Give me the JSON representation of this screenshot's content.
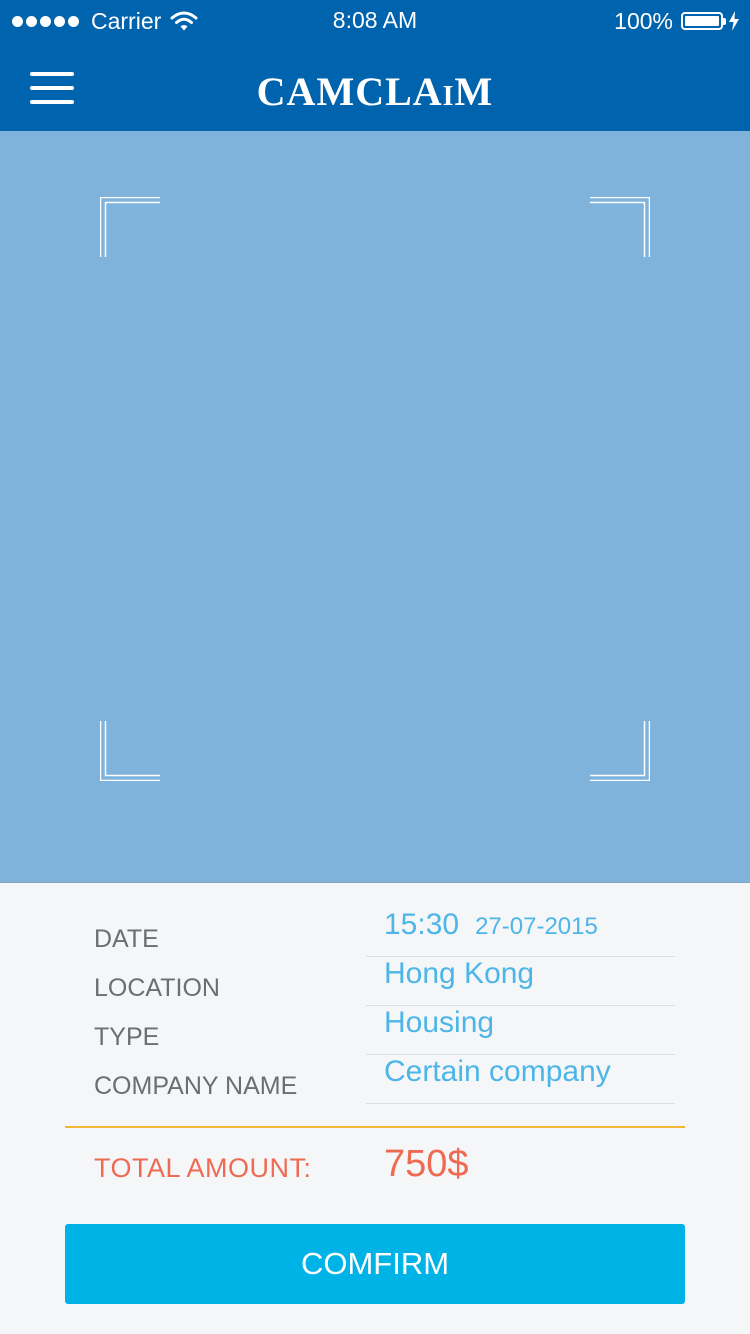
{
  "status_bar": {
    "carrier": "Carrier",
    "time": "8:08 AM",
    "battery": "100%",
    "icons": [
      "signal-dots-icon",
      "wifi-icon",
      "battery-icon",
      "charging-bolt-icon"
    ]
  },
  "header": {
    "app_title": "CAMCLAiM",
    "menu_icon": "hamburger-menu-icon"
  },
  "viewfinder": {
    "icons": [
      "corner-bracket-icon"
    ],
    "background_color": "#7fb3db"
  },
  "details": {
    "fields": [
      {
        "label": "DATE",
        "time": "15:30",
        "date": "27-07-2015"
      },
      {
        "label": "LOCATION",
        "value": "Hong Kong"
      },
      {
        "label": "TYPE",
        "value": "Housing"
      },
      {
        "label": "COMPANY NAME",
        "value": "Certain company"
      }
    ],
    "total_label": "TOTAL AMOUNT:",
    "total_value": "750$"
  },
  "actions": {
    "confirm_label": "COMFIRM"
  },
  "colors": {
    "brand": "#0063ad",
    "value_text": "#4cb6e8",
    "total_text": "#ef6a52",
    "divider": "#f3b63a",
    "button": "#00b3e6"
  }
}
